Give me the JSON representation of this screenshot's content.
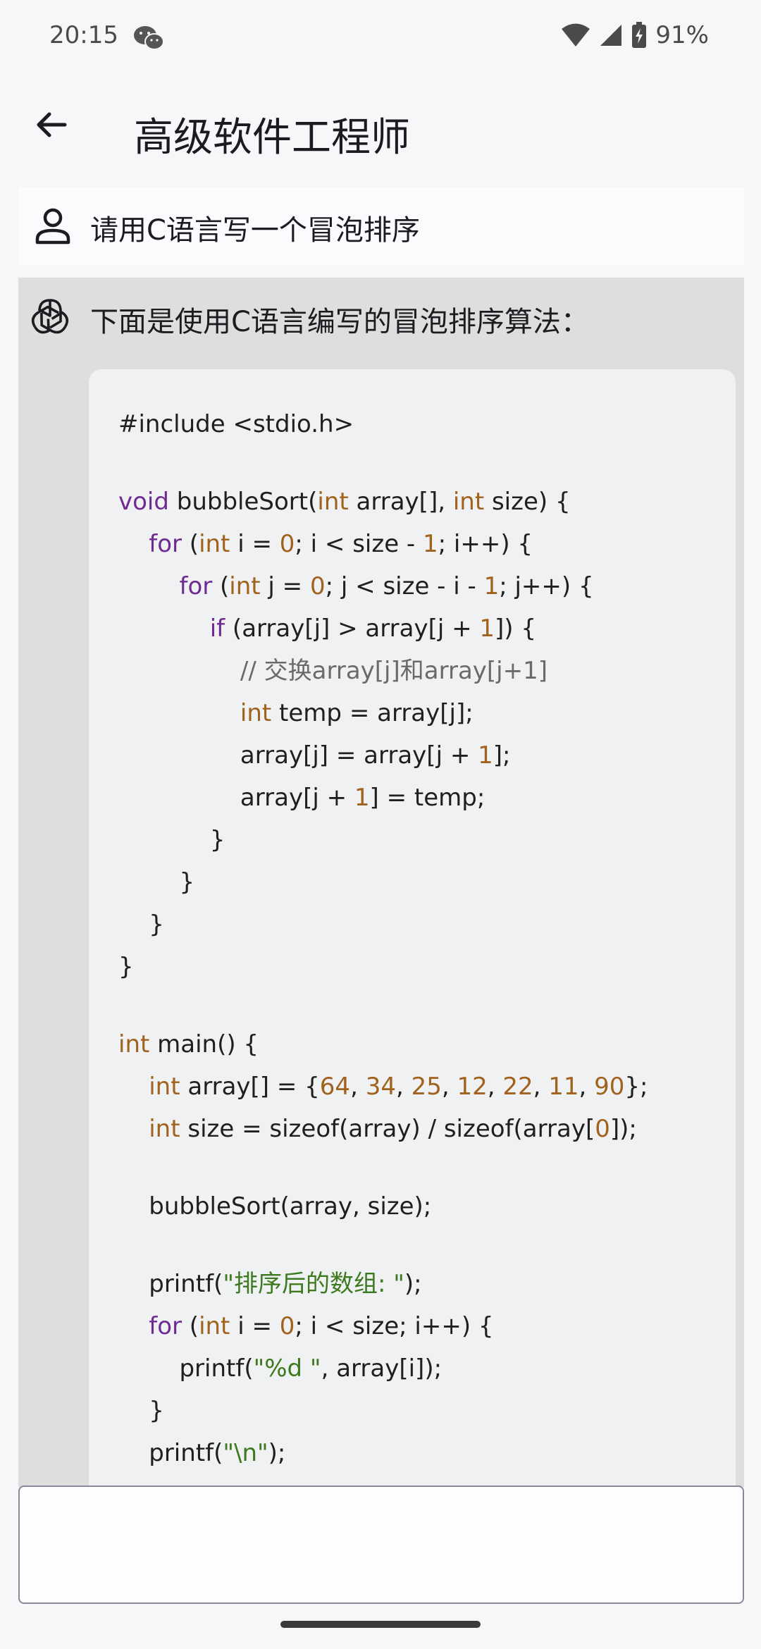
{
  "status": {
    "time": "20:15",
    "battery": "91%"
  },
  "app_bar": {
    "title": "高级软件工程师"
  },
  "user_message": {
    "text": "请用C语言写一个冒泡排序"
  },
  "bot_message": {
    "intro": "下面是使用C语言编写的冒泡排序算法：",
    "code_lines": [
      [
        [
          "",
          "#include <stdio.h>"
        ]
      ],
      [],
      [
        [
          "kw",
          "void"
        ],
        [
          "",
          " bubbleSort("
        ],
        [
          "ty",
          "int"
        ],
        [
          "",
          " array[], "
        ],
        [
          "ty",
          "int"
        ],
        [
          "",
          " size) {"
        ]
      ],
      [
        [
          "",
          "    "
        ],
        [
          "kw",
          "for"
        ],
        [
          "",
          " ("
        ],
        [
          "ty",
          "int"
        ],
        [
          "",
          " i = "
        ],
        [
          "num",
          "0"
        ],
        [
          "",
          "; i < size - "
        ],
        [
          "num",
          "1"
        ],
        [
          "",
          "; i++) {"
        ]
      ],
      [
        [
          "",
          "        "
        ],
        [
          "kw",
          "for"
        ],
        [
          "",
          " ("
        ],
        [
          "ty",
          "int"
        ],
        [
          "",
          " j = "
        ],
        [
          "num",
          "0"
        ],
        [
          "",
          "; j < size - i - "
        ],
        [
          "num",
          "1"
        ],
        [
          "",
          "; j++) {"
        ]
      ],
      [
        [
          "",
          "            "
        ],
        [
          "kw",
          "if"
        ],
        [
          "",
          " (array[j] > array[j + "
        ],
        [
          "num",
          "1"
        ],
        [
          "",
          "]) {"
        ]
      ],
      [
        [
          "",
          "                "
        ],
        [
          "com",
          "// 交换array[j]和array[j+1]"
        ]
      ],
      [
        [
          "",
          "                "
        ],
        [
          "ty",
          "int"
        ],
        [
          "",
          " temp = array[j];"
        ]
      ],
      [
        [
          "",
          "                array[j] = array[j + "
        ],
        [
          "num",
          "1"
        ],
        [
          "",
          "];"
        ]
      ],
      [
        [
          "",
          "                array[j + "
        ],
        [
          "num",
          "1"
        ],
        [
          "",
          "] = temp;"
        ]
      ],
      [
        [
          "",
          "            }"
        ]
      ],
      [
        [
          "",
          "        }"
        ]
      ],
      [
        [
          "",
          "    }"
        ]
      ],
      [
        [
          "",
          "}"
        ]
      ],
      [],
      [
        [
          "ty",
          "int"
        ],
        [
          "",
          " main() {"
        ]
      ],
      [
        [
          "",
          "    "
        ],
        [
          "ty",
          "int"
        ],
        [
          "",
          " array[] = {"
        ],
        [
          "num",
          "64"
        ],
        [
          "",
          ", "
        ],
        [
          "num",
          "34"
        ],
        [
          "",
          ", "
        ],
        [
          "num",
          "25"
        ],
        [
          "",
          ", "
        ],
        [
          "num",
          "12"
        ],
        [
          "",
          ", "
        ],
        [
          "num",
          "22"
        ],
        [
          "",
          ", "
        ],
        [
          "num",
          "11"
        ],
        [
          "",
          ", "
        ],
        [
          "num",
          "90"
        ],
        [
          "",
          "};"
        ]
      ],
      [
        [
          "",
          "    "
        ],
        [
          "ty",
          "int"
        ],
        [
          "",
          " size = sizeof(array) / sizeof(array["
        ],
        [
          "num",
          "0"
        ],
        [
          "",
          "]);"
        ]
      ],
      [],
      [
        [
          "",
          "    bubbleSort(array, size);"
        ]
      ],
      [],
      [
        [
          "",
          "    printf("
        ],
        [
          "str",
          "\"排序后的数组: \""
        ],
        [
          "",
          ");"
        ]
      ],
      [
        [
          "",
          "    "
        ],
        [
          "kw",
          "for"
        ],
        [
          "",
          " ("
        ],
        [
          "ty",
          "int"
        ],
        [
          "",
          " i = "
        ],
        [
          "num",
          "0"
        ],
        [
          "",
          "; i < size; i++) {"
        ]
      ],
      [
        [
          "",
          "        printf("
        ],
        [
          "str",
          "\"%d \""
        ],
        [
          "",
          ", array[i]);"
        ]
      ],
      [
        [
          "",
          "    }"
        ]
      ],
      [
        [
          "",
          "    printf("
        ],
        [
          "str",
          "\"\\n\""
        ],
        [
          "",
          ");"
        ]
      ]
    ]
  },
  "input": {
    "placeholder": ""
  },
  "icons": {
    "back": "arrow-back-icon",
    "user": "person-icon",
    "bot": "openai-logo-icon",
    "wechat": "wechat-icon",
    "wifi": "wifi-icon",
    "signal": "cell-signal-icon",
    "battery": "battery-charging-icon"
  }
}
